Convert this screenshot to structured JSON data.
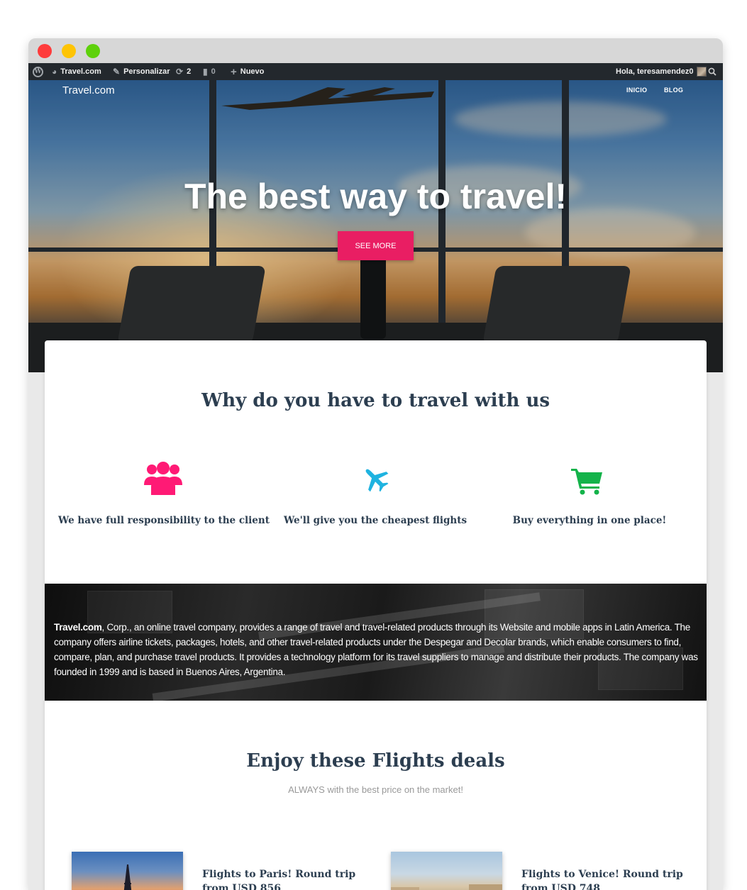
{
  "adminbar": {
    "site_name": "Travel.com",
    "customize_label": "Personalizar",
    "updates_count": "2",
    "comments_count": "0",
    "new_label": "Nuevo",
    "greeting": "Hola, teresamendez0"
  },
  "site": {
    "brand": "Travel.com",
    "nav": [
      "INICIO",
      "BLOG"
    ]
  },
  "hero": {
    "title": "The best way to travel!",
    "button_label": "SEE MORE"
  },
  "why": {
    "title": "Why do you have to travel with us",
    "features": [
      {
        "icon": "users-icon",
        "label": "We have full responsibility to the client",
        "color": "#ff1a75"
      },
      {
        "icon": "plane-icon",
        "label": "We'll give you the cheapest flights",
        "color": "#1fb3e0"
      },
      {
        "icon": "cart-icon",
        "label": "Buy everything in one place!",
        "color": "#14b34a"
      }
    ]
  },
  "about": {
    "brand": "Travel.com",
    "text": ", Corp., an online travel company, provides a range of travel and travel-related products through its Website and mobile apps in Latin America. The company offers airline tickets, packages, hotels, and other travel-related products under the Despegar and Decolar brands, which enable consumers to find, compare, plan, and purchase travel products. It provides a technology platform for its travel suppliers to manage and distribute their products. The company was founded in 1999 and is based in Buenos Aires, Argentina."
  },
  "deals": {
    "title": "Enjoy these Flights deals",
    "subtitle": "ALWAYS with the best price on the market!",
    "items": [
      {
        "title": "Flights to Paris! Round trip from USD 856"
      },
      {
        "title": "Flights to Venice! Round trip from USD 748"
      }
    ]
  },
  "colors": {
    "accent": "#e91e63",
    "heading": "#2c3e50",
    "adminbar": "#23282d"
  }
}
